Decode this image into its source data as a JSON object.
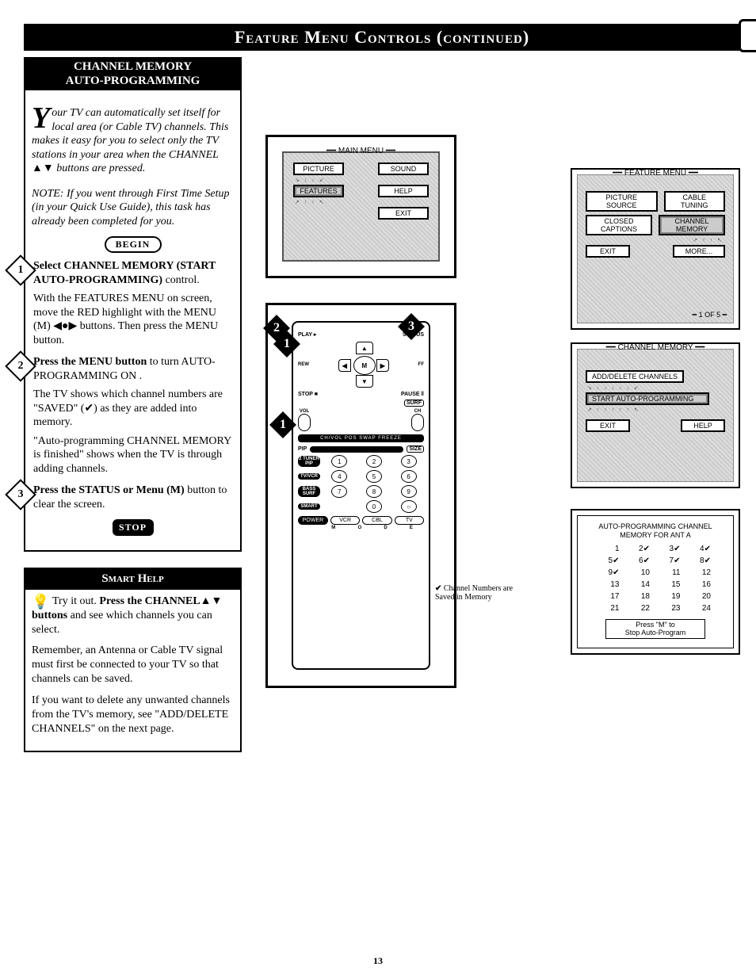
{
  "header": "Feature Menu Controls (continued)",
  "page_number": "13",
  "left": {
    "section_title_1": "CHANNEL MEMORY",
    "section_title_2": "AUTO-PROGRAMMING",
    "drop_cap": "Y",
    "intro_rest": "our TV can automatically set itself for local area (or Cable TV) channels. This makes it easy for you to select only the TV stations in your area when the CHANNEL ▲▼ buttons are pressed.",
    "note": "NOTE: If you went through First Time Setup (in your Quick Use Guide), this task has already been completed for you.",
    "begin": "BEGIN",
    "step1_lead": "Select CHANNEL MEMORY (START AUTO-PROGRAMMING)",
    "step1_tail": " control.",
    "step1_p2": "With the FEATURES MENU on screen, move the RED highlight with the MENU (M) ◀●▶ buttons. Then press the MENU button.",
    "step2_lead": "Press the MENU button",
    "step2_tail": " to turn AUTO-PROGRAMMING ON .",
    "step2_p2": "The TV shows which channel numbers are \"SAVED\" (✔) as they are added into memory.",
    "step2_p3": "\"Auto-programming CHANNEL MEMORY is finished\" shows when the TV is through adding channels.",
    "step3_lead": "Press the STATUS or Menu (M)",
    "step3_tail": " button to clear the screen.",
    "stop": "STOP",
    "smart_title": "Smart Help",
    "smart_lead1": "Try it out. ",
    "smart_lead2": "Press the CHANNEL▲▼ buttons",
    "smart_tail": " and see which channels you can select.",
    "smart_p2": "Remember, an Antenna or Cable TV signal must first be connected to your TV so that channels can be saved.",
    "smart_p3": "If you want to delete any unwanted channels from the TV's memory, see \"ADD/DELETE CHANNELS\" on the next page."
  },
  "main_menu": {
    "title": "MAIN MENU",
    "buttons": [
      "PICTURE",
      "SOUND",
      "FEATURES",
      "HELP",
      "EXIT"
    ]
  },
  "feature_menu": {
    "title": "FEATURE MENU",
    "buttons": [
      "PICTURE SOURCE",
      "CABLE TUNING",
      "CLOSED CAPTIONS",
      "CHANNEL MEMORY",
      "EXIT",
      "MORE..."
    ],
    "page_ind": "1 OF 5"
  },
  "channel_memory_menu": {
    "title": "CHANNEL MEMORY",
    "buttons": [
      "ADD/DELETE CHANNELS",
      "START AUTO-PROGRAMMING",
      "EXIT",
      "HELP"
    ]
  },
  "auto_prog": {
    "title1": "AUTO-PROGRAMMING CHANNEL",
    "title2": "MEMORY FOR ANT A",
    "press1": "Press \"M\" to",
    "press2": "Stop Auto-Program",
    "channels": [
      {
        "n": "1",
        "saved": false
      },
      {
        "n": "2",
        "saved": true
      },
      {
        "n": "3",
        "saved": true
      },
      {
        "n": "4",
        "saved": true
      },
      {
        "n": "5",
        "saved": true
      },
      {
        "n": "6",
        "saved": true
      },
      {
        "n": "7",
        "saved": true
      },
      {
        "n": "8",
        "saved": true
      },
      {
        "n": "9",
        "saved": true
      },
      {
        "n": "10",
        "saved": false
      },
      {
        "n": "11",
        "saved": false
      },
      {
        "n": "12",
        "saved": false
      },
      {
        "n": "13",
        "saved": false
      },
      {
        "n": "14",
        "saved": false
      },
      {
        "n": "15",
        "saved": false
      },
      {
        "n": "16",
        "saved": false
      },
      {
        "n": "17",
        "saved": false
      },
      {
        "n": "18",
        "saved": false
      },
      {
        "n": "19",
        "saved": false
      },
      {
        "n": "20",
        "saved": false
      },
      {
        "n": "21",
        "saved": false
      },
      {
        "n": "22",
        "saved": false
      },
      {
        "n": "23",
        "saved": false
      },
      {
        "n": "24",
        "saved": false
      }
    ]
  },
  "remote": {
    "play": "PLAY ▸",
    "status": "STATUS",
    "rew": "REW",
    "ff": "FF",
    "m": "M",
    "stop": "STOP ■",
    "pause": "PAUSE ‖",
    "surf": "SURF",
    "vol": "VOL",
    "ch": "CH",
    "strip": "CH/VOL   POS   SWAP   FREEZE",
    "pip": "PIP",
    "size": "SIZE",
    "row_labels": [
      "2 TUNER PIP",
      "TV/VCR",
      "BASS SURF",
      "SMART"
    ],
    "nums": [
      "1",
      "2",
      "3",
      "4",
      "5",
      "6",
      "7",
      "8",
      "9",
      "0"
    ],
    "power": "POWER",
    "bottom": [
      "VCR",
      "CBL",
      "TV"
    ],
    "mode": [
      "M",
      "O",
      "D",
      "E"
    ]
  },
  "saved_note": "Channel Numbers are Saved in Memory",
  "diamonds": {
    "1": "1",
    "2": "2",
    "3": "3"
  }
}
